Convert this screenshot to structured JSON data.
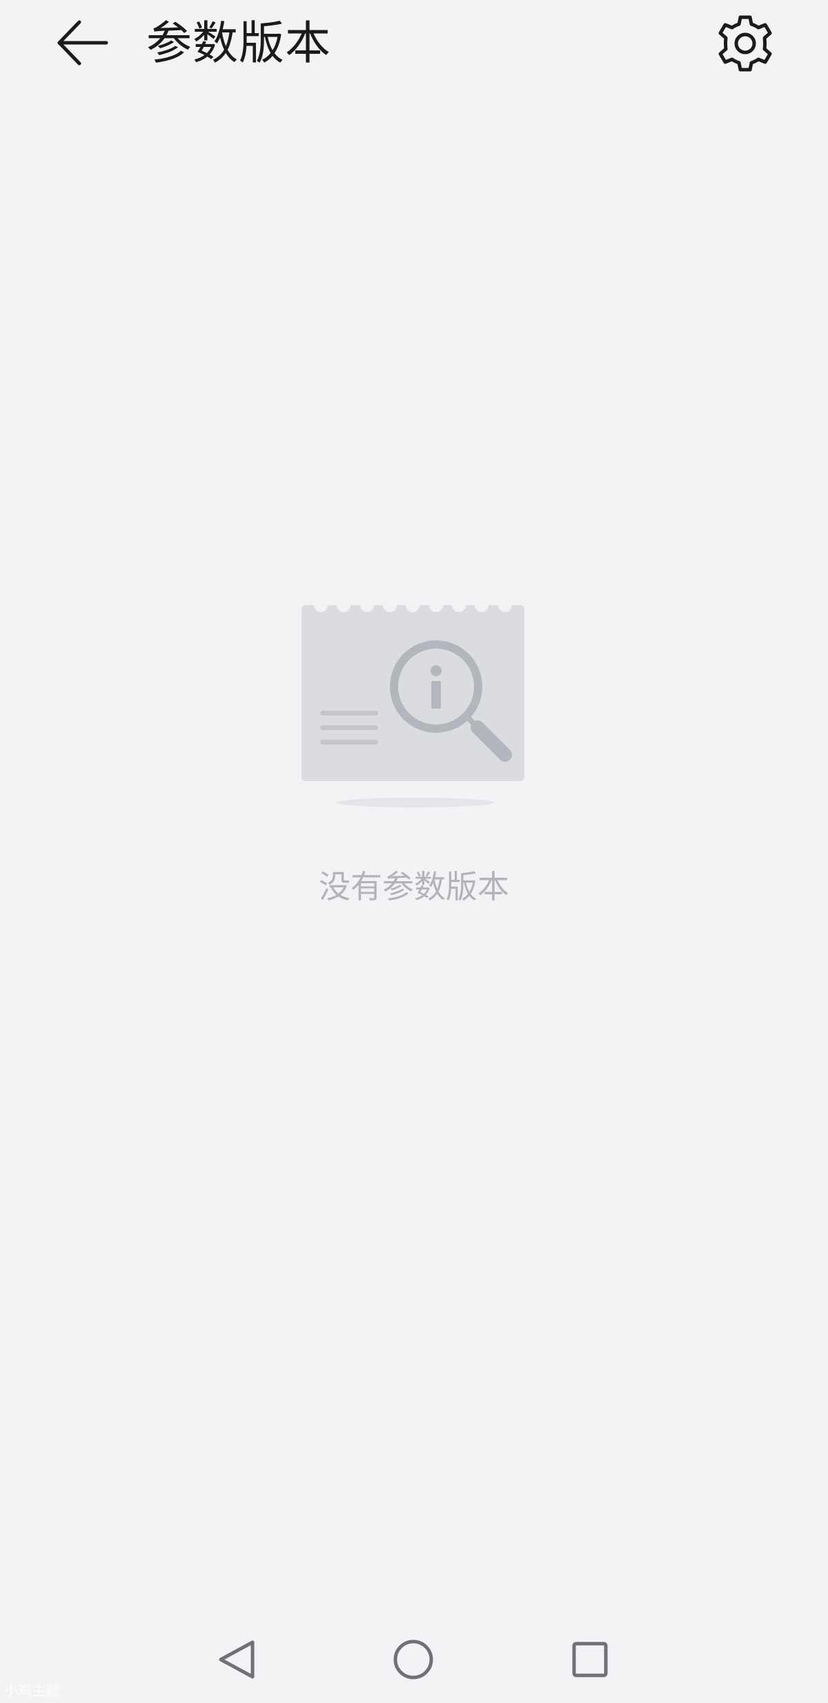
{
  "header": {
    "title": "参数版本",
    "back_icon": "arrow-left-icon",
    "settings_icon": "gear-icon"
  },
  "empty_state": {
    "illustration_icon": "info-magnifier-icon",
    "message": "没有参数版本"
  },
  "nav_bar": {
    "back_icon": "triangle-back-icon",
    "home_icon": "circle-home-icon",
    "recent_icon": "square-recents-icon"
  },
  "watermark": "小鸡主题",
  "colors": {
    "background": "#f2f3f5",
    "title": "#1b1b1b",
    "empty_text": "#b2b4b8",
    "illustration_card": "#dadce0",
    "illustration_accent": "#b4b6bd"
  }
}
